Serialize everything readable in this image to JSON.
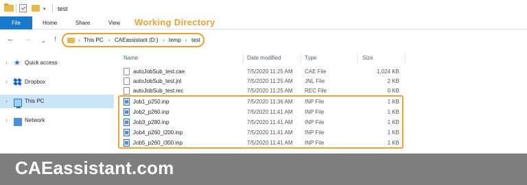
{
  "window": {
    "title": "test"
  },
  "ribbon": {
    "tabs": [
      "File",
      "Home",
      "Share",
      "View"
    ]
  },
  "annotation": {
    "working_directory": "Working Directory"
  },
  "address": {
    "crumbs": [
      "This PC",
      "CAEassistant (D:)",
      "temp",
      "test"
    ]
  },
  "nav": {
    "items": [
      {
        "label": "Quick access",
        "icon": "star-icon"
      },
      {
        "label": "Dropbox",
        "icon": "dropbox-icon"
      },
      {
        "label": "This PC",
        "icon": "computer-icon",
        "selected": true
      },
      {
        "label": "Network",
        "icon": "network-icon"
      }
    ]
  },
  "columns": {
    "name": "Name",
    "date": "Date modified",
    "type": "Type",
    "size": "Size"
  },
  "files": [
    {
      "name": "autoJobSub_test.cae",
      "date": "7/5/2020 11:25 AM",
      "type": "CAE File",
      "size": "1,024 KB",
      "icon": "file-icon"
    },
    {
      "name": "autoJobSub_test.jnl",
      "date": "7/5/2020 11:25 AM",
      "type": "JNL File",
      "size": "2 KB",
      "icon": "file-icon"
    },
    {
      "name": "autoJobSub_test.rec",
      "date": "7/5/2020 11:25 AM",
      "type": "REC File",
      "size": "0 KB",
      "icon": "file-icon"
    },
    {
      "name": "Job1_p250.inp",
      "date": "7/5/2020 11:36 AM",
      "type": "INP File",
      "size": "1 KB",
      "icon": "inp-file-icon"
    },
    {
      "name": "Job2_p260.inp",
      "date": "7/5/2020 11:41 AM",
      "type": "INP File",
      "size": "1 KB",
      "icon": "inp-file-icon"
    },
    {
      "name": "Job3_p280.inp",
      "date": "7/5/2020 11:41 AM",
      "type": "INP File",
      "size": "1 KB",
      "icon": "inp-file-icon"
    },
    {
      "name": "Job4_p260_l200.inp",
      "date": "7/5/2020 11:41 AM",
      "type": "INP File",
      "size": "1 KB",
      "icon": "inp-file-icon"
    },
    {
      "name": "Job5_p260_l300.inp",
      "date": "7/5/2020 11:41 AM",
      "type": "INP File",
      "size": "1 KB",
      "icon": "inp-file-icon"
    }
  ],
  "footer": {
    "brand": "CAEassistant.com"
  },
  "colors": {
    "accent": "#f0a030",
    "file_tab": "#1979ca",
    "selection": "#cce4f7",
    "footer": "#7f7f7f"
  }
}
